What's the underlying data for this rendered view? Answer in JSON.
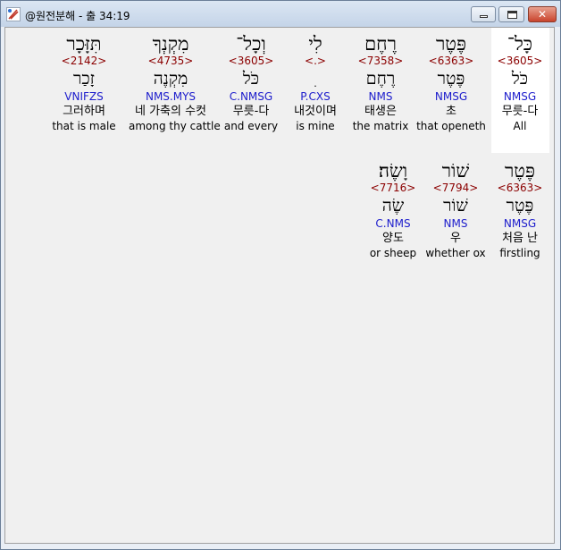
{
  "window": {
    "title": "@원전분해 - 출 34:19",
    "minimize_label": "",
    "maximize_label": "",
    "close_label": "✕"
  },
  "rows": [
    {
      "words": [
        {
          "hebrew": "כָּל־",
          "strong": "<3605>",
          "lemma": "כֹּל",
          "morph": "NMSG",
          "korean": "무릇-다",
          "english": "All"
        },
        {
          "hebrew": "פֶּטֶר",
          "strong": "<6363>",
          "lemma": "פֶּטֶר",
          "morph": "NMSG",
          "korean": "초",
          "english": "that openeth"
        },
        {
          "hebrew": "רֶחֶם",
          "strong": "<7358>",
          "lemma": "רֶחֶם",
          "morph": "NMS",
          "korean": "태생은",
          "english": "the matrix"
        },
        {
          "hebrew": "לִי",
          "strong": "<.>",
          "lemma": "ִ",
          "morph": "P.CXS",
          "korean": "내것이며",
          "english": "is mine"
        },
        {
          "hebrew": "וְכָל־",
          "strong": "<3605>",
          "lemma": "כֹּל",
          "morph": "C.NMSG",
          "korean": "무릇-다",
          "english": "and every"
        },
        {
          "hebrew": "מִקְנְךָ",
          "strong": "<4735>",
          "lemma": "מִקְנֶה",
          "morph": "NMS.MYS",
          "korean": "네 가축의 수컷",
          "english": "among thy cattle"
        },
        {
          "hebrew": "תִּזָּכָר",
          "strong": "<2142>",
          "lemma": "זָכַר",
          "morph": "VNIFZS",
          "korean": "그러하며",
          "english": "that is male"
        }
      ]
    },
    {
      "words": [
        {
          "hebrew": "פֶּטֶר",
          "strong": "<6363>",
          "lemma": "פֶּטֶר",
          "morph": "NMSG",
          "korean": "처음 난",
          "english": "firstling"
        },
        {
          "hebrew": "שׁוֹר",
          "strong": "<7794>",
          "lemma": "שׁוֹר",
          "morph": "NMS",
          "korean": "우",
          "english": "whether ox"
        },
        {
          "hebrew": "וָשֶׂה׃",
          "strong": "<7716>",
          "lemma": "שֶׂה",
          "morph": "C.NMS",
          "korean": "양도",
          "english": "or sheep"
        }
      ]
    }
  ]
}
